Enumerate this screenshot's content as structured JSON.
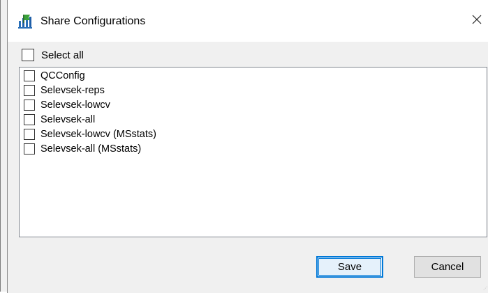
{
  "window": {
    "title": "Share Configurations",
    "icon": "skyline-app-icon",
    "close_icon": "close-icon"
  },
  "select_all": {
    "label": "Select all",
    "checked": false
  },
  "configurations": [
    {
      "label": "QCConfig",
      "checked": false
    },
    {
      "label": "Selevsek-reps",
      "checked": false
    },
    {
      "label": "Selevsek-lowcv",
      "checked": false
    },
    {
      "label": "Selevsek-all",
      "checked": false
    },
    {
      "label": "Selevsek-lowcv (MSstats)",
      "checked": false
    },
    {
      "label": "Selevsek-all (MSstats)",
      "checked": false
    }
  ],
  "buttons": {
    "save_label": "Save",
    "cancel_label": "Cancel"
  },
  "colors": {
    "accent": "#0078d7",
    "dialog_bg": "#f0f0f0",
    "list_bg": "#ffffff"
  }
}
